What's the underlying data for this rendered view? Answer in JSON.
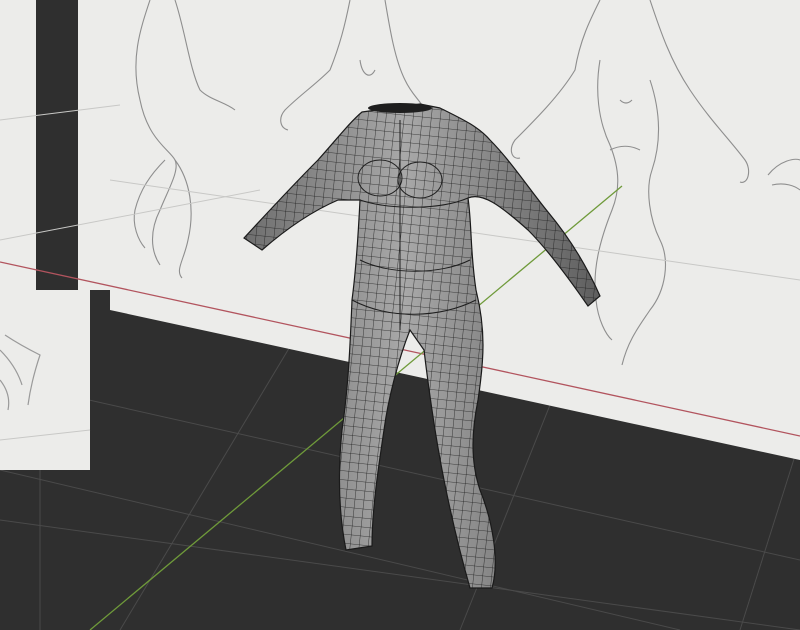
{
  "viewport": {
    "view_type": "3d-perspective",
    "background_color": "#2f2f2f",
    "floor_color": "#2f2f2f",
    "grid_line_color": "#4a4a4a",
    "x_axis_color": "#b2545e",
    "y_axis_color": "#6f9a3a",
    "reference_planes": [
      {
        "name": "reference-image-side",
        "fill": "#ececea",
        "content": "figure-sketch-side-pose"
      },
      {
        "name": "reference-image-front",
        "fill": "#ececea",
        "content": "figure-sketch-front-pose"
      }
    ],
    "mesh": {
      "name": "body-base-mesh",
      "shading": "wireframe-on-shaded",
      "fill": "#8c8c8c",
      "wire_color": "#1e1e1e"
    }
  }
}
